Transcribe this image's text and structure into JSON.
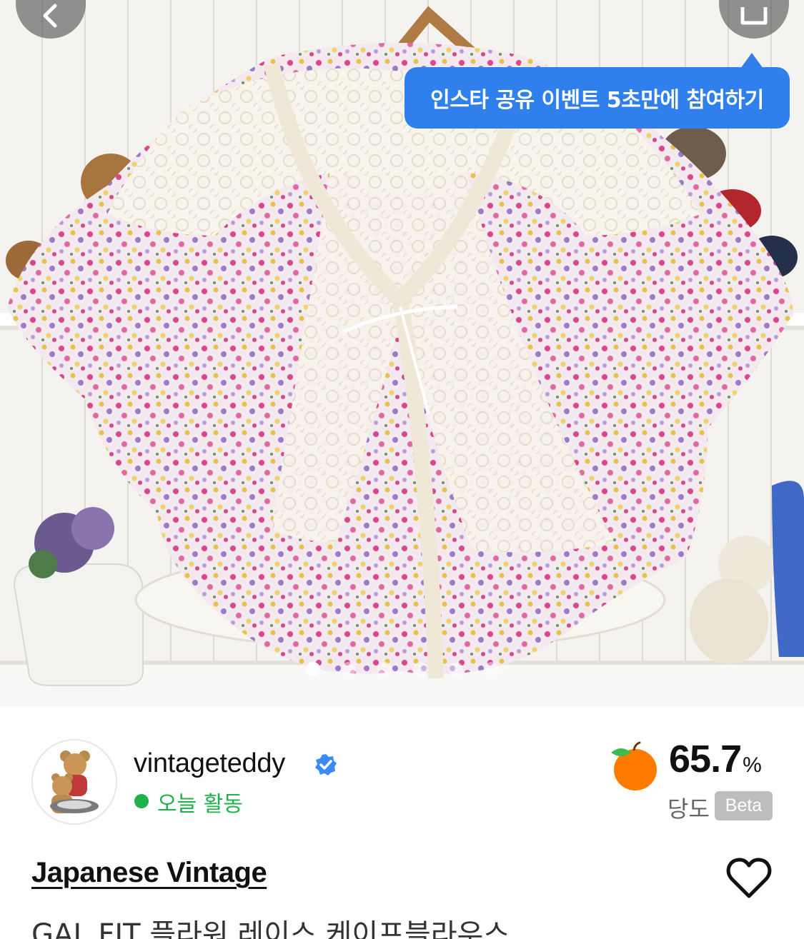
{
  "header": {
    "back_icon": "chevron-left-icon",
    "share_icon": "share-icon"
  },
  "promo_tooltip": {
    "text": "인스타 공유 이벤트 5초만에 참여하기",
    "color": "#2f80ed"
  },
  "image_carousel": {
    "total": 6,
    "active_index": 0
  },
  "seller": {
    "name": "vintageteddy",
    "verified": true,
    "status": "오늘 활동",
    "status_color": "#20b24a"
  },
  "rating": {
    "value": "65.7",
    "unit": "%",
    "label": "당도",
    "badge": "Beta",
    "icon": "apple-icon"
  },
  "product": {
    "brand": "Japanese Vintage",
    "title": "GAL FIT 플라워 레이스 케이프블라우스",
    "favorite_icon": "heart-icon"
  }
}
